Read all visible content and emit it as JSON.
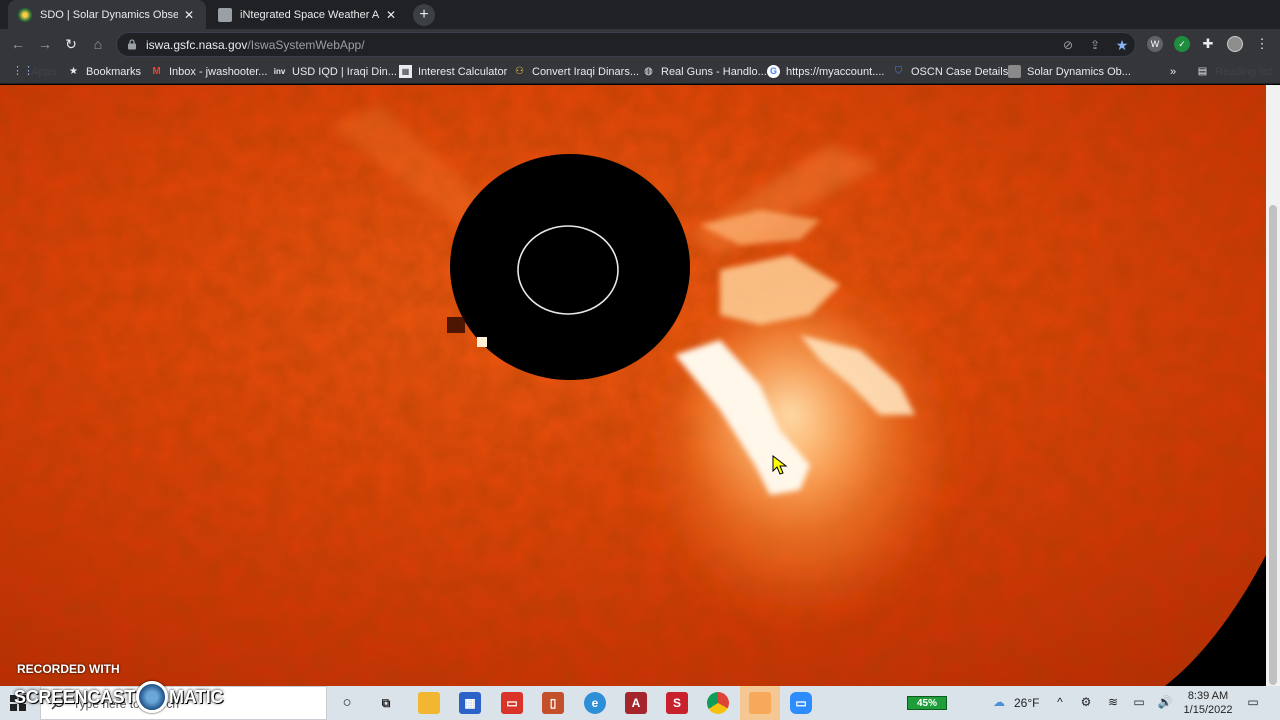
{
  "browser": {
    "tabs": [
      {
        "title": "SDO | Solar Dynamics Observato",
        "active": true
      },
      {
        "title": "iNtegrated Space Weather Analy",
        "active": false
      }
    ],
    "new_tab_label": "+",
    "address": {
      "host": "iswa.gsfc.nasa.gov",
      "path": "/IswaSystemWebApp/"
    },
    "bookmarks": [
      {
        "label": "Apps",
        "icon": "apps-grid-icon"
      },
      {
        "label": "Bookmarks",
        "icon": "star-icon"
      },
      {
        "label": "Inbox - jwashooter...",
        "icon": "gmail-icon"
      },
      {
        "label": "USD IQD | Iraqi Din...",
        "icon": "inv-icon"
      },
      {
        "label": "Interest Calculator",
        "icon": "calculator-icon"
      },
      {
        "label": "Convert Iraqi Dinars...",
        "icon": "currency-icon"
      },
      {
        "label": "Real Guns - Handlo...",
        "icon": "globe-icon"
      },
      {
        "label": "https://myaccount....",
        "icon": "google-icon"
      },
      {
        "label": "OSCN Case Details",
        "icon": "shield-icon"
      },
      {
        "label": "Solar Dynamics Ob...",
        "icon": "satellite-icon"
      }
    ],
    "bookmarks_overflow": "»",
    "reading_list": "Reading list"
  },
  "watermark": {
    "line1": "RECORDED WITH",
    "line2a": "SCREENCAST",
    "line2b": "MATIC"
  },
  "taskbar": {
    "search_placeholder": "Type here to search",
    "battery": "45%",
    "temperature": "26°F",
    "time": "8:39 AM",
    "date": "1/15/2022"
  },
  "colors": {
    "corona_base": "#d93a06",
    "occulter": "#000000",
    "cme_core": "#ffffff",
    "tab_strip": "#202124",
    "toolbar": "#35363a",
    "taskbar": "#dbe3ea"
  }
}
